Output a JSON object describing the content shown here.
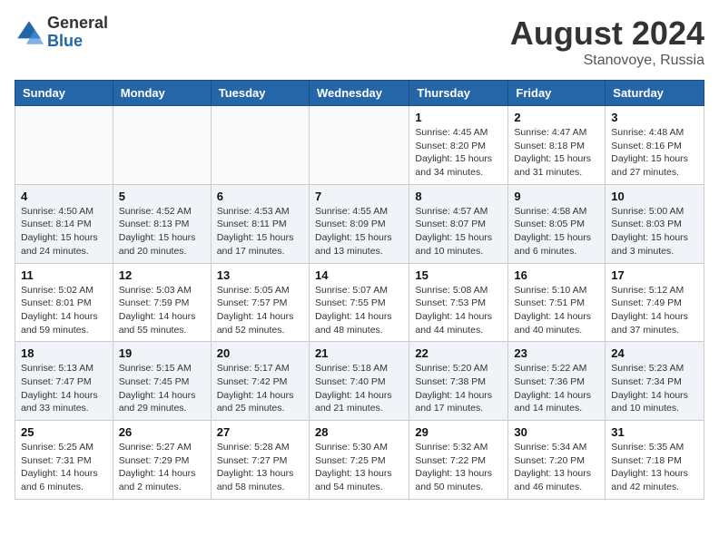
{
  "logo": {
    "general": "General",
    "blue": "Blue"
  },
  "title": {
    "month_year": "August 2024",
    "location": "Stanovoye, Russia"
  },
  "days_of_week": [
    "Sunday",
    "Monday",
    "Tuesday",
    "Wednesday",
    "Thursday",
    "Friday",
    "Saturday"
  ],
  "weeks": [
    [
      {
        "day": "",
        "info": ""
      },
      {
        "day": "",
        "info": ""
      },
      {
        "day": "",
        "info": ""
      },
      {
        "day": "",
        "info": ""
      },
      {
        "day": "1",
        "info": "Sunrise: 4:45 AM\nSunset: 8:20 PM\nDaylight: 15 hours\nand 34 minutes."
      },
      {
        "day": "2",
        "info": "Sunrise: 4:47 AM\nSunset: 8:18 PM\nDaylight: 15 hours\nand 31 minutes."
      },
      {
        "day": "3",
        "info": "Sunrise: 4:48 AM\nSunset: 8:16 PM\nDaylight: 15 hours\nand 27 minutes."
      }
    ],
    [
      {
        "day": "4",
        "info": "Sunrise: 4:50 AM\nSunset: 8:14 PM\nDaylight: 15 hours\nand 24 minutes."
      },
      {
        "day": "5",
        "info": "Sunrise: 4:52 AM\nSunset: 8:13 PM\nDaylight: 15 hours\nand 20 minutes."
      },
      {
        "day": "6",
        "info": "Sunrise: 4:53 AM\nSunset: 8:11 PM\nDaylight: 15 hours\nand 17 minutes."
      },
      {
        "day": "7",
        "info": "Sunrise: 4:55 AM\nSunset: 8:09 PM\nDaylight: 15 hours\nand 13 minutes."
      },
      {
        "day": "8",
        "info": "Sunrise: 4:57 AM\nSunset: 8:07 PM\nDaylight: 15 hours\nand 10 minutes."
      },
      {
        "day": "9",
        "info": "Sunrise: 4:58 AM\nSunset: 8:05 PM\nDaylight: 15 hours\nand 6 minutes."
      },
      {
        "day": "10",
        "info": "Sunrise: 5:00 AM\nSunset: 8:03 PM\nDaylight: 15 hours\nand 3 minutes."
      }
    ],
    [
      {
        "day": "11",
        "info": "Sunrise: 5:02 AM\nSunset: 8:01 PM\nDaylight: 14 hours\nand 59 minutes."
      },
      {
        "day": "12",
        "info": "Sunrise: 5:03 AM\nSunset: 7:59 PM\nDaylight: 14 hours\nand 55 minutes."
      },
      {
        "day": "13",
        "info": "Sunrise: 5:05 AM\nSunset: 7:57 PM\nDaylight: 14 hours\nand 52 minutes."
      },
      {
        "day": "14",
        "info": "Sunrise: 5:07 AM\nSunset: 7:55 PM\nDaylight: 14 hours\nand 48 minutes."
      },
      {
        "day": "15",
        "info": "Sunrise: 5:08 AM\nSunset: 7:53 PM\nDaylight: 14 hours\nand 44 minutes."
      },
      {
        "day": "16",
        "info": "Sunrise: 5:10 AM\nSunset: 7:51 PM\nDaylight: 14 hours\nand 40 minutes."
      },
      {
        "day": "17",
        "info": "Sunrise: 5:12 AM\nSunset: 7:49 PM\nDaylight: 14 hours\nand 37 minutes."
      }
    ],
    [
      {
        "day": "18",
        "info": "Sunrise: 5:13 AM\nSunset: 7:47 PM\nDaylight: 14 hours\nand 33 minutes."
      },
      {
        "day": "19",
        "info": "Sunrise: 5:15 AM\nSunset: 7:45 PM\nDaylight: 14 hours\nand 29 minutes."
      },
      {
        "day": "20",
        "info": "Sunrise: 5:17 AM\nSunset: 7:42 PM\nDaylight: 14 hours\nand 25 minutes."
      },
      {
        "day": "21",
        "info": "Sunrise: 5:18 AM\nSunset: 7:40 PM\nDaylight: 14 hours\nand 21 minutes."
      },
      {
        "day": "22",
        "info": "Sunrise: 5:20 AM\nSunset: 7:38 PM\nDaylight: 14 hours\nand 17 minutes."
      },
      {
        "day": "23",
        "info": "Sunrise: 5:22 AM\nSunset: 7:36 PM\nDaylight: 14 hours\nand 14 minutes."
      },
      {
        "day": "24",
        "info": "Sunrise: 5:23 AM\nSunset: 7:34 PM\nDaylight: 14 hours\nand 10 minutes."
      }
    ],
    [
      {
        "day": "25",
        "info": "Sunrise: 5:25 AM\nSunset: 7:31 PM\nDaylight: 14 hours\nand 6 minutes."
      },
      {
        "day": "26",
        "info": "Sunrise: 5:27 AM\nSunset: 7:29 PM\nDaylight: 14 hours\nand 2 minutes."
      },
      {
        "day": "27",
        "info": "Sunrise: 5:28 AM\nSunset: 7:27 PM\nDaylight: 13 hours\nand 58 minutes."
      },
      {
        "day": "28",
        "info": "Sunrise: 5:30 AM\nSunset: 7:25 PM\nDaylight: 13 hours\nand 54 minutes."
      },
      {
        "day": "29",
        "info": "Sunrise: 5:32 AM\nSunset: 7:22 PM\nDaylight: 13 hours\nand 50 minutes."
      },
      {
        "day": "30",
        "info": "Sunrise: 5:34 AM\nSunset: 7:20 PM\nDaylight: 13 hours\nand 46 minutes."
      },
      {
        "day": "31",
        "info": "Sunrise: 5:35 AM\nSunset: 7:18 PM\nDaylight: 13 hours\nand 42 minutes."
      }
    ]
  ]
}
